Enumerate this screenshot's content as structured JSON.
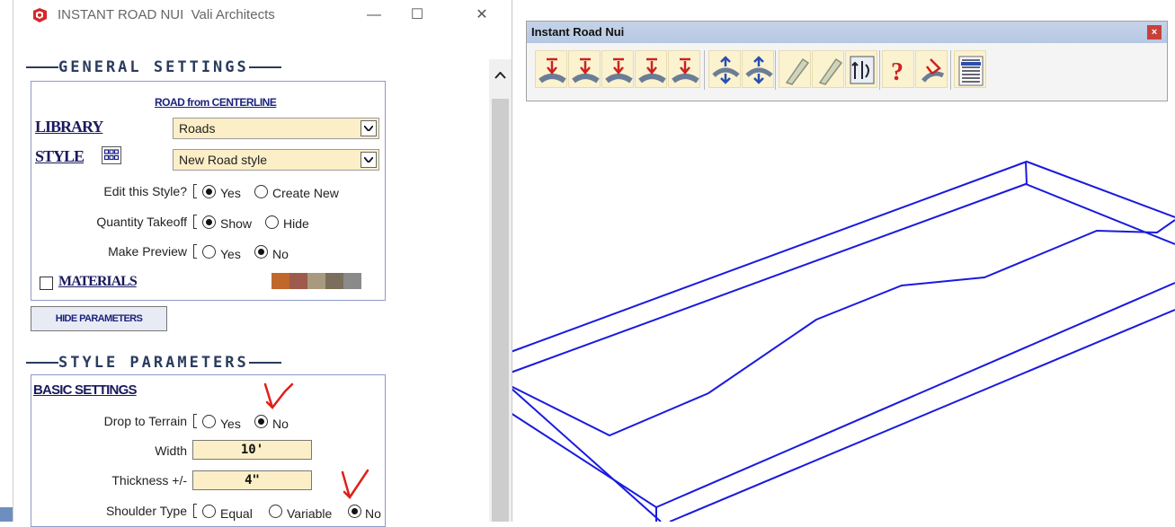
{
  "dialog": {
    "app_name": "INSTANT ROAD NUI",
    "company": "Vali Architects",
    "minimize_symbol": "—",
    "maximize_symbol": "☐",
    "close_symbol": "✕",
    "general_heading": "GENERAL SETTINGS",
    "road_caption": "ROAD from CENTERLINE",
    "library_label": "LIBRARY",
    "library_value": "Roads",
    "style_label": "STYLE",
    "style_value": "New Road style",
    "edit_style_label": "Edit this Style?",
    "edit_style_options": [
      "Yes",
      "Create New"
    ],
    "edit_style_selected": "Yes",
    "quantity_label": "Quantity Takeoff",
    "quantity_options": [
      "Show",
      "Hide"
    ],
    "quantity_selected": "Show",
    "preview_label": "Make Preview",
    "preview_options": [
      "Yes",
      "No"
    ],
    "preview_selected": "No",
    "materials_label": "MATERIALS",
    "materials_checked": false,
    "material_swatches": [
      "#c0672b",
      "#9e5a4d",
      "#a89a7e",
      "#7b6e5c",
      "#8a8a8a"
    ],
    "hide_parameters_button": "HIDE PARAMETERS",
    "style_params_heading": "STYLE PARAMETERS",
    "basic_settings": "BASIC SETTINGS",
    "drop_terrain_label": "Drop to Terrain",
    "drop_terrain_options": [
      "Yes",
      "No"
    ],
    "drop_terrain_selected": "No",
    "width_label": "Width",
    "width_value": "10'",
    "thickness_label": "Thickness +/-",
    "thickness_value": "4\"",
    "shoulder_label": "Shoulder Type",
    "shoulder_options": [
      "Equal",
      "Variable",
      "No"
    ],
    "shoulder_selected": "No"
  },
  "toolbar": {
    "title": "Instant Road Nui",
    "close_symbol": "×",
    "tools": [
      "road-from-centerline-icon",
      "road-from-edges-icon",
      "road-from-surface-icon",
      "road-add-icon",
      "road-edit-icon",
      "intersection-icon",
      "crossing-icon",
      "curb-icon",
      "curb-edit-icon",
      "interchange-icon",
      "help-icon",
      "settings-icon",
      "menu-list-icon"
    ]
  },
  "colors": {
    "model_edges": "#0000ff",
    "heading": "#2a3b5e",
    "input_bg": "#fcefc7",
    "annotation": "#e0201a"
  }
}
